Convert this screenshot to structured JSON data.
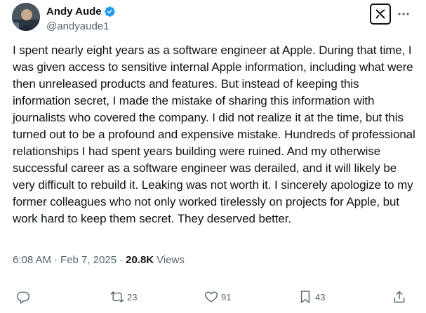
{
  "author": {
    "display_name": "Andy Aude",
    "handle": "@andyaude1",
    "verified": true
  },
  "tweet": {
    "text": "I spent nearly eight years as a software engineer at Apple. During that time, I was given access to sensitive internal Apple information, including what were then unreleased products and features. But instead of keeping this information secret, I made the mistake of sharing this information with journalists who covered the company. I did not realize it at the time, but this turned out to be a profound and expensive mistake. Hundreds of professional relationships I had spent years building were ruined. And my otherwise successful career as a software engineer was derailed, and it will likely be very difficult to rebuild it. Leaking was not worth it. I sincerely apologize to my former colleagues who not only worked tirelessly on projects for Apple, but work hard to keep them secret. They deserved better.",
    "time": "6:08 AM",
    "separator": "·",
    "date": "Feb 7, 2025",
    "views_count": "20.8K",
    "views_label": "Views"
  },
  "actions": {
    "reply_count": "",
    "retweet_count": "23",
    "like_count": "91",
    "bookmark_count": "43"
  },
  "colors": {
    "text": "#0f1419",
    "secondary": "#536471",
    "verified": "#1d9bf0"
  },
  "icons": {
    "verified": "verified-badge-icon",
    "grok": "grok-icon",
    "more": "more-icon",
    "reply": "reply-icon",
    "retweet": "retweet-icon",
    "like": "heart-icon",
    "bookmark": "bookmark-icon",
    "share": "share-icon"
  }
}
